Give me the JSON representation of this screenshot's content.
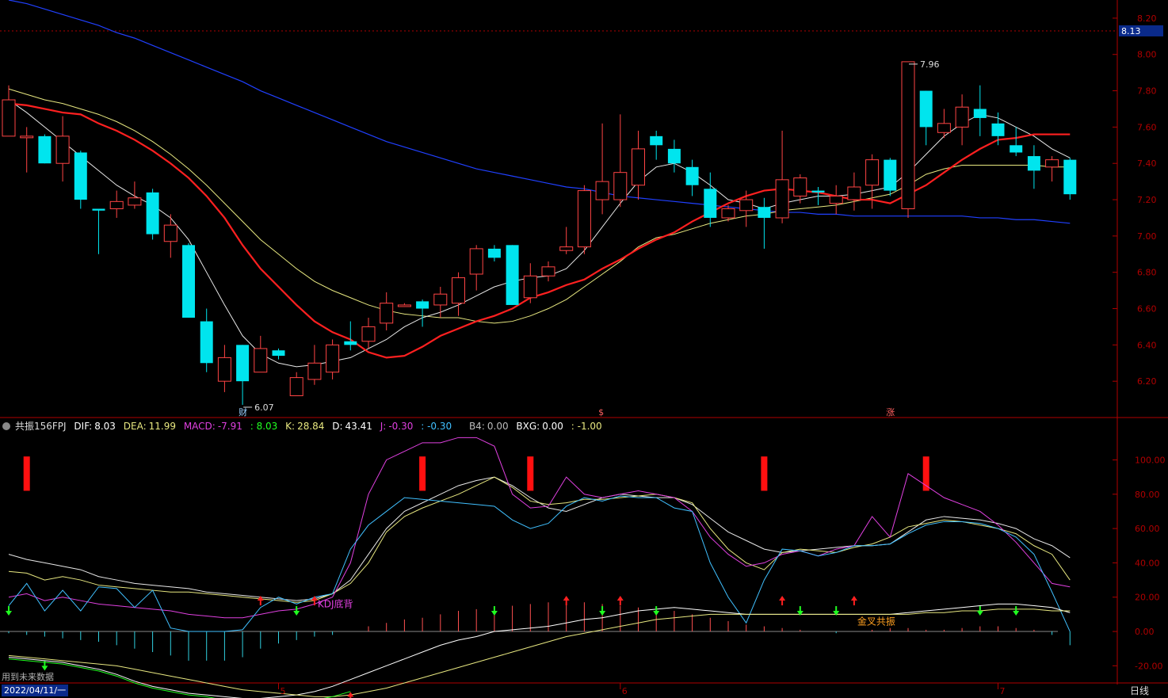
{
  "indicator": {
    "name": "共振156FPJ",
    "dif_label": "DIF:",
    "dif": "8.03",
    "dea_label": "DEA:",
    "dea": "11.99",
    "macd_label": "MACD:",
    "macd": "-7.91",
    "extra": ": 8.03",
    "k_label": "K:",
    "k": "28.84",
    "d_label": "D:",
    "d": "43.41",
    "j_label": "J:",
    "j": "-0.30",
    "j2": ": -0.30",
    "b4_label": "B4:",
    "b4": "0.00",
    "bxg_label": "BXG:",
    "bxg": "0.00",
    "last": ": -1.00"
  },
  "footer": {
    "note": "用到未来数据",
    "date": "2022/04/11/一",
    "period": "日线"
  },
  "colors": {
    "up": "#ff4444",
    "down": "#00e5ee",
    "ma_red": "#ff2020",
    "ma_white": "#e8e8e8",
    "ma_yellow": "#e8e880",
    "ma_blue": "#2040ff",
    "axis": "#b00000",
    "magenta": "#e040e0",
    "cyan": "#40c0ff",
    "green": "#20ff20"
  },
  "chart_data": [
    {
      "type": "candlestick",
      "price_axis": {
        "ylim": [
          6.0,
          8.3
        ],
        "ticks": [
          "6.20",
          "6.40",
          "6.60",
          "6.80",
          "7.00",
          "7.20",
          "7.40",
          "7.60",
          "7.80",
          "8.00",
          "8.20"
        ],
        "current": "8.13"
      },
      "candles": [
        [
          7.55,
          7.75,
          7.83,
          7.55
        ],
        [
          7.55,
          7.55,
          7.6,
          7.35
        ],
        [
          7.55,
          7.4,
          7.56,
          7.4
        ],
        [
          7.4,
          7.55,
          7.66,
          7.3
        ],
        [
          7.46,
          7.2,
          7.47,
          7.15
        ],
        [
          7.15,
          7.14,
          7.15,
          6.9
        ],
        [
          7.15,
          7.19,
          7.25,
          7.1
        ],
        [
          7.17,
          7.21,
          7.3,
          7.15
        ],
        [
          7.24,
          7.01,
          7.26,
          6.98
        ],
        [
          6.97,
          7.06,
          7.12,
          6.88
        ],
        [
          6.95,
          6.55,
          6.96,
          6.55
        ],
        [
          6.53,
          6.3,
          6.6,
          6.25
        ],
        [
          6.2,
          6.33,
          6.4,
          6.14
        ],
        [
          6.4,
          6.2,
          6.4,
          6.07
        ],
        [
          6.25,
          6.38,
          6.45,
          6.26
        ],
        [
          6.37,
          6.34,
          6.38,
          6.32
        ],
        [
          6.12,
          6.22,
          6.25,
          6.12
        ],
        [
          6.21,
          6.3,
          6.4,
          6.18
        ],
        [
          6.25,
          6.4,
          6.43,
          6.21
        ],
        [
          6.42,
          6.4,
          6.53,
          6.37
        ],
        [
          6.42,
          6.5,
          6.55,
          6.38
        ],
        [
          6.52,
          6.63,
          6.69,
          6.48
        ],
        [
          6.62,
          6.62,
          6.63,
          6.61
        ],
        [
          6.64,
          6.6,
          6.65,
          6.5
        ],
        [
          6.62,
          6.68,
          6.72,
          6.55
        ],
        [
          6.63,
          6.77,
          6.8,
          6.56
        ],
        [
          6.79,
          6.93,
          6.95,
          6.7
        ],
        [
          6.93,
          6.88,
          6.95,
          6.86
        ],
        [
          6.95,
          6.62,
          6.95,
          6.62
        ],
        [
          6.66,
          6.78,
          6.85,
          6.63
        ],
        [
          6.78,
          6.83,
          6.86,
          6.75
        ],
        [
          6.92,
          6.94,
          7.05,
          6.9
        ],
        [
          6.94,
          7.25,
          7.28,
          6.9
        ],
        [
          7.2,
          7.3,
          7.62,
          7.12
        ],
        [
          7.2,
          7.35,
          7.67,
          7.16
        ],
        [
          7.28,
          7.48,
          7.58,
          7.2
        ],
        [
          7.55,
          7.5,
          7.58,
          7.42
        ],
        [
          7.48,
          7.4,
          7.53,
          7.35
        ],
        [
          7.38,
          7.28,
          7.42,
          7.22
        ],
        [
          7.26,
          7.1,
          7.35,
          7.05
        ],
        [
          7.1,
          7.15,
          7.17,
          7.08
        ],
        [
          7.14,
          7.2,
          7.25,
          7.05
        ],
        [
          7.16,
          7.1,
          7.21,
          6.93
        ],
        [
          7.1,
          7.31,
          7.58,
          7.07
        ],
        [
          7.22,
          7.32,
          7.34,
          7.18
        ],
        [
          7.25,
          7.24,
          7.27,
          7.17
        ],
        [
          7.18,
          7.22,
          7.28,
          7.12
        ],
        [
          7.2,
          7.27,
          7.35,
          7.14
        ],
        [
          7.28,
          7.42,
          7.45,
          7.15
        ],
        [
          7.42,
          7.25,
          7.43,
          7.22
        ],
        [
          7.15,
          7.96,
          7.96,
          7.1
        ],
        [
          7.8,
          7.6,
          7.8,
          7.5
        ],
        [
          7.57,
          7.62,
          7.7,
          7.54
        ],
        [
          7.6,
          7.71,
          7.78,
          7.5
        ],
        [
          7.7,
          7.65,
          7.83,
          7.55
        ],
        [
          7.62,
          7.55,
          7.68,
          7.5
        ],
        [
          7.5,
          7.46,
          7.6,
          7.44
        ],
        [
          7.44,
          7.36,
          7.5,
          7.26
        ],
        [
          7.38,
          7.42,
          7.44,
          7.3
        ],
        [
          7.42,
          7.23,
          7.43,
          7.2
        ]
      ],
      "ma_red": [
        7.73,
        7.72,
        7.7,
        7.68,
        7.67,
        7.62,
        7.58,
        7.53,
        7.47,
        7.4,
        7.32,
        7.22,
        7.1,
        6.95,
        6.82,
        6.72,
        6.62,
        6.53,
        6.47,
        6.43,
        6.36,
        6.33,
        6.34,
        6.39,
        6.45,
        6.49,
        6.53,
        6.56,
        6.6,
        6.66,
        6.69,
        6.73,
        6.76,
        6.82,
        6.87,
        6.93,
        6.98,
        7.02,
        7.08,
        7.13,
        7.18,
        7.22,
        7.25,
        7.26,
        7.25,
        7.24,
        7.22,
        7.2,
        7.2,
        7.18,
        7.23,
        7.28,
        7.35,
        7.42,
        7.48,
        7.53,
        7.54,
        7.56,
        7.56,
        7.56
      ],
      "ma_white": [
        7.75,
        7.68,
        7.6,
        7.52,
        7.44,
        7.36,
        7.28,
        7.22,
        7.17,
        7.1,
        6.98,
        6.8,
        6.62,
        6.45,
        6.35,
        6.3,
        6.28,
        6.29,
        6.31,
        6.33,
        6.38,
        6.43,
        6.5,
        6.55,
        6.58,
        6.62,
        6.67,
        6.72,
        6.75,
        6.77,
        6.78,
        6.82,
        6.92,
        7.05,
        7.18,
        7.3,
        7.38,
        7.4,
        7.35,
        7.28,
        7.2,
        7.18,
        7.15,
        7.18,
        7.2,
        7.22,
        7.22,
        7.23,
        7.25,
        7.27,
        7.35,
        7.45,
        7.55,
        7.62,
        7.67,
        7.65,
        7.6,
        7.55,
        7.48,
        7.43
      ],
      "ma_yellow": [
        7.81,
        7.78,
        7.75,
        7.73,
        7.7,
        7.67,
        7.63,
        7.58,
        7.52,
        7.45,
        7.37,
        7.28,
        7.18,
        7.08,
        6.98,
        6.9,
        6.82,
        6.75,
        6.7,
        6.66,
        6.62,
        6.59,
        6.57,
        6.56,
        6.55,
        6.55,
        6.53,
        6.52,
        6.53,
        6.56,
        6.6,
        6.65,
        6.72,
        6.79,
        6.86,
        6.94,
        6.99,
        7.01,
        7.04,
        7.07,
        7.09,
        7.11,
        7.12,
        7.14,
        7.15,
        7.16,
        7.17,
        7.19,
        7.21,
        7.23,
        7.28,
        7.34,
        7.37,
        7.39,
        7.39,
        7.39,
        7.39,
        7.39,
        7.38,
        7.38
      ],
      "ma_blue": [
        8.3,
        8.28,
        8.25,
        8.22,
        8.19,
        8.16,
        8.12,
        8.09,
        8.05,
        8.01,
        7.97,
        7.93,
        7.89,
        7.85,
        7.8,
        7.76,
        7.72,
        7.68,
        7.64,
        7.6,
        7.56,
        7.52,
        7.49,
        7.46,
        7.43,
        7.4,
        7.37,
        7.35,
        7.33,
        7.31,
        7.29,
        7.27,
        7.26,
        7.24,
        7.22,
        7.21,
        7.2,
        7.19,
        7.18,
        7.17,
        7.16,
        7.15,
        7.14,
        7.13,
        7.13,
        7.12,
        7.12,
        7.11,
        7.11,
        7.11,
        7.11,
        7.11,
        7.11,
        7.11,
        7.1,
        7.1,
        7.09,
        7.09,
        7.08,
        7.07
      ],
      "annotations": [
        {
          "text": "7.96",
          "index": 50,
          "value": 7.96
        },
        {
          "text": "6.07",
          "index": 13,
          "value": 6.07
        }
      ],
      "markers": [
        {
          "text": "财",
          "index": 13
        },
        {
          "text": "$",
          "index": 33
        },
        {
          "text": "涨",
          "index": 49
        }
      ]
    },
    {
      "type": "line",
      "ylim": [
        -30,
        115
      ],
      "ticks": [
        "-20.00",
        "0.00",
        "20.00",
        "40.00",
        "60.00",
        "80.00",
        "100.00"
      ],
      "series": [
        {
          "name": "K",
          "color": "#e8e8e8",
          "values": [
            45,
            42,
            40,
            38,
            36,
            32,
            30,
            28,
            27,
            26,
            25,
            23,
            22,
            21,
            20,
            19,
            18,
            19,
            22,
            30,
            45,
            60,
            70,
            75,
            80,
            85,
            88,
            90,
            85,
            78,
            72,
            70,
            74,
            78,
            80,
            79,
            78,
            78,
            74,
            66,
            58,
            53,
            48,
            46,
            47,
            48,
            49,
            50,
            50,
            51,
            58,
            65,
            67,
            66,
            65,
            63,
            60,
            54,
            50,
            43
          ]
        },
        {
          "name": "D",
          "color": "#e8e880",
          "values": [
            35,
            34,
            30,
            32,
            30,
            27,
            26,
            25,
            24,
            23,
            23,
            22,
            21,
            20,
            19,
            18,
            17,
            18,
            22,
            28,
            40,
            58,
            67,
            72,
            76,
            80,
            85,
            90,
            84,
            76,
            74,
            75,
            77,
            77,
            78,
            79,
            80,
            78,
            75,
            60,
            48,
            40,
            36,
            46,
            48,
            47,
            46,
            49,
            51,
            55,
            61,
            63,
            65,
            64,
            62,
            60,
            57,
            50,
            45,
            30
          ]
        },
        {
          "name": "J",
          "color": "#e040e0",
          "values": [
            20,
            22,
            18,
            20,
            18,
            16,
            15,
            14,
            13,
            12,
            10,
            9,
            8,
            8,
            10,
            12,
            13,
            16,
            20,
            40,
            80,
            100,
            105,
            110,
            110,
            113,
            113,
            108,
            80,
            72,
            73,
            90,
            80,
            78,
            80,
            82,
            80,
            78,
            70,
            55,
            45,
            38,
            40,
            45,
            47,
            44,
            48,
            50,
            67,
            55,
            92,
            85,
            78,
            74,
            70,
            62,
            52,
            40,
            28,
            26
          ]
        },
        {
          "name": "cyan",
          "color": "#40c0ff",
          "values": [
            15,
            28,
            12,
            24,
            12,
            26,
            25,
            14,
            24,
            2,
            0,
            0,
            0,
            1,
            14,
            20,
            16,
            20,
            22,
            48,
            62,
            70,
            78,
            77,
            76,
            75,
            74,
            73,
            65,
            60,
            63,
            73,
            78,
            76,
            79,
            78,
            78,
            72,
            70,
            40,
            20,
            5,
            30,
            48,
            47,
            44,
            46,
            50,
            50,
            51,
            57,
            62,
            64,
            64,
            63,
            60,
            55,
            45,
            23,
            0
          ]
        },
        {
          "name": "DIF",
          "color": "#ffffff",
          "values": [
            -15,
            -16,
            -17,
            -18,
            -20,
            -22,
            -25,
            -29,
            -32,
            -34,
            -36,
            -37,
            -38,
            -39,
            -39,
            -38,
            -37,
            -35,
            -32,
            -28,
            -24,
            -20,
            -16,
            -12,
            -8,
            -5,
            -3,
            0,
            1,
            2,
            3,
            5,
            7,
            8,
            10,
            12,
            13,
            14,
            13,
            12,
            11,
            10,
            10,
            10,
            10,
            10,
            10,
            10,
            10,
            10,
            11,
            12,
            13,
            14,
            15,
            16,
            16,
            15,
            14,
            11
          ]
        },
        {
          "name": "DEA",
          "color": "#e8e880",
          "values": [
            -14,
            -15,
            -16,
            -17,
            -18,
            -19,
            -20,
            -22,
            -24,
            -26,
            -28,
            -30,
            -32,
            -34,
            -35,
            -36,
            -37,
            -38,
            -38,
            -37,
            -35,
            -33,
            -30,
            -27,
            -24,
            -21,
            -18,
            -15,
            -12,
            -9,
            -6,
            -3,
            -1,
            1,
            3,
            5,
            7,
            8,
            9,
            10,
            10,
            10,
            10,
            10,
            10,
            10,
            10,
            10,
            10,
            10,
            10,
            11,
            11,
            12,
            12,
            13,
            13,
            13,
            12,
            12
          ]
        },
        {
          "name": "green",
          "color": "#20ff20",
          "values": [
            -16,
            -17,
            -18,
            -19,
            -21,
            -23,
            -26,
            -30,
            -33,
            -35,
            -37,
            -38,
            -40,
            -41,
            -42,
            -42,
            -41,
            -40,
            -38,
            -35
          ]
        }
      ],
      "macd": [
        -1,
        -2,
        -3,
        -4,
        -5,
        -6,
        -8,
        -10,
        -12,
        -14,
        -17,
        -17,
        -17,
        -15,
        -10,
        -7,
        -5,
        -3,
        -2,
        0,
        3,
        5,
        7,
        8,
        10,
        12,
        13,
        14,
        15,
        16,
        17,
        18,
        17,
        16,
        15,
        14,
        13,
        12,
        10,
        8,
        6,
        4,
        3,
        2,
        1,
        0,
        -1,
        0,
        1,
        2,
        2,
        1,
        1,
        2,
        3,
        3,
        2,
        1,
        -2,
        -8
      ],
      "red_bars": [
        1,
        23,
        29,
        42,
        51
      ],
      "arrows_up": [
        14,
        17,
        31,
        34,
        43,
        47,
        19
      ],
      "arrows_down": [
        0,
        2,
        16,
        27,
        33,
        36,
        44,
        46,
        54,
        56
      ],
      "labels": [
        {
          "text": "KDJ底背",
          "index": 17
        },
        {
          "text": "金叉共振",
          "index": 47
        }
      ],
      "x_ticks": [
        {
          "text": "5",
          "index": 15
        },
        {
          "text": "6",
          "index": 34
        },
        {
          "text": "7",
          "index": 55
        }
      ]
    }
  ]
}
